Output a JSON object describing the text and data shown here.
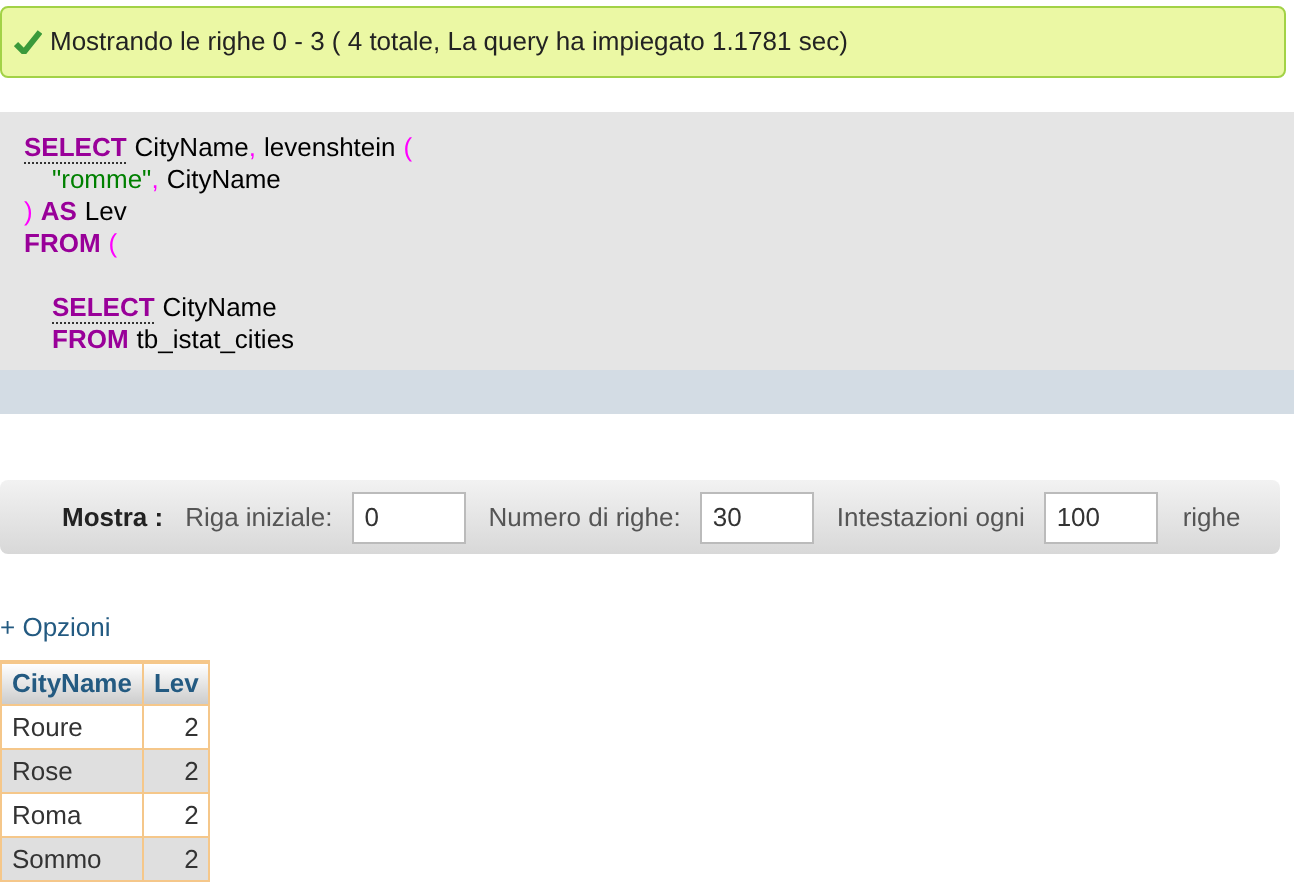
{
  "message": {
    "kind": "success",
    "text": "Mostrando le righe 0 - 3 ( 4 totale, La query ha impiegato 1.1781 sec)"
  },
  "sql": [
    {
      "indented": false,
      "tokens": [
        {
          "kind": "keyword",
          "text": "SELECT",
          "dotted": true
        },
        {
          "kind": "ident",
          "text": "CityName",
          "trailing": ","
        },
        {
          "kind": "ident",
          "text": "levenshtein"
        },
        {
          "kind": "punct",
          "text": "("
        }
      ]
    },
    {
      "indented": true,
      "tokens": [
        {
          "kind": "string",
          "text": "\"romme\"",
          "trailing": ","
        },
        {
          "kind": "ident",
          "text": "CityName"
        }
      ]
    },
    {
      "indented": false,
      "tokens": [
        {
          "kind": "punct",
          "text": ")"
        },
        {
          "kind": "keyword",
          "text": "AS",
          "dotted": false
        },
        {
          "kind": "ident",
          "text": "Lev"
        }
      ]
    },
    {
      "indented": false,
      "tokens": [
        {
          "kind": "keyword",
          "text": "FROM",
          "dotted": false
        },
        {
          "kind": "punct",
          "text": "("
        }
      ]
    },
    {
      "indented": true,
      "blank_line_before": true,
      "tokens": [
        {
          "kind": "keyword",
          "text": "SELECT",
          "dotted": true
        },
        {
          "kind": "ident",
          "text": "CityName"
        }
      ]
    },
    {
      "indented": true,
      "tokens": [
        {
          "kind": "keyword",
          "text": "FROM",
          "dotted": false
        },
        {
          "kind": "ident",
          "text": "tb_istat_cities"
        }
      ]
    }
  ],
  "navigation": {
    "title": "Mostra :",
    "fields": [
      {
        "label": "Riga iniziale:",
        "value": "0"
      },
      {
        "label": "Numero di righe:",
        "value": "30"
      },
      {
        "label": "Intestazioni ogni",
        "value": "100"
      }
    ],
    "suffix": "righe"
  },
  "options_link": "+ Opzioni",
  "table": {
    "columns": [
      "CityName",
      "Lev"
    ],
    "rows": [
      [
        "Roure",
        "2"
      ],
      [
        "Rose",
        "2"
      ],
      [
        "Roma",
        "2"
      ],
      [
        "Sommo",
        "2"
      ]
    ]
  }
}
